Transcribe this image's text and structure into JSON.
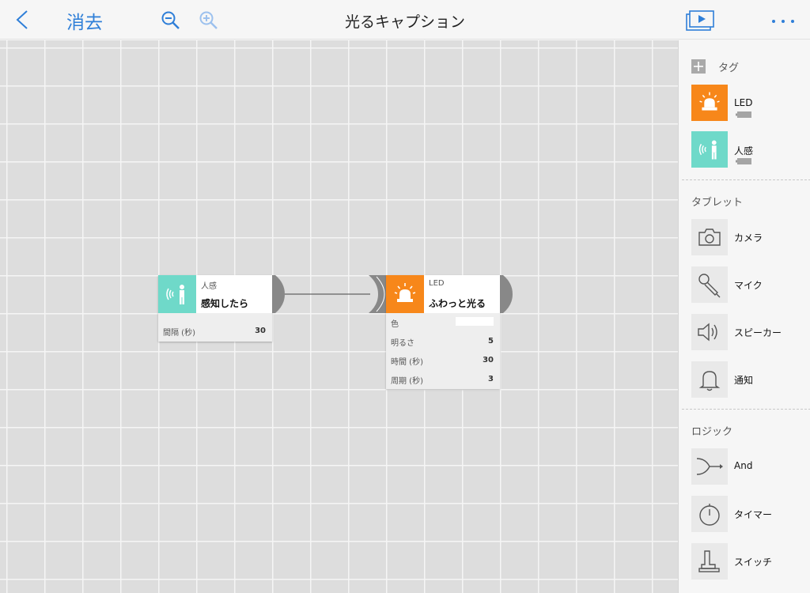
{
  "header": {
    "back_label": "<",
    "clear_label": "消去",
    "title": "光るキャプション"
  },
  "canvas": {
    "nodes": [
      {
        "category": "人感",
        "name": "感知したら",
        "color": "#6fd9c9",
        "params": [
          {
            "label": "間隔 (秒)",
            "value": "30"
          }
        ]
      },
      {
        "category": "LED",
        "name": "ふわっと光る",
        "color": "#f7871a",
        "params": [
          {
            "label": "色",
            "value": ""
          },
          {
            "label": "明るさ",
            "value": "5"
          },
          {
            "label": "時間 (秒)",
            "value": "30"
          },
          {
            "label": "周期 (秒)",
            "value": "3"
          }
        ]
      }
    ]
  },
  "sidebar": {
    "tags": {
      "header": "タグ",
      "items": [
        {
          "label": "LED",
          "icon": "siren-icon",
          "color": "#f7871a"
        },
        {
          "label": "人感",
          "icon": "motion-sensor-icon",
          "color": "#6fd9c9"
        }
      ]
    },
    "tablet": {
      "header": "タブレット",
      "items": [
        {
          "label": "カメラ",
          "icon": "camera-icon"
        },
        {
          "label": "マイク",
          "icon": "microphone-icon"
        },
        {
          "label": "スピーカー",
          "icon": "speaker-icon"
        },
        {
          "label": "通知",
          "icon": "bell-icon"
        }
      ]
    },
    "logic": {
      "header": "ロジック",
      "items": [
        {
          "label": "And",
          "icon": "and-icon"
        },
        {
          "label": "タイマー",
          "icon": "timer-icon"
        },
        {
          "label": "スイッチ",
          "icon": "switch-icon"
        }
      ]
    }
  },
  "colors": {
    "accent": "#2f7fd8",
    "led": "#f7871a",
    "motion": "#6fd9c9"
  }
}
